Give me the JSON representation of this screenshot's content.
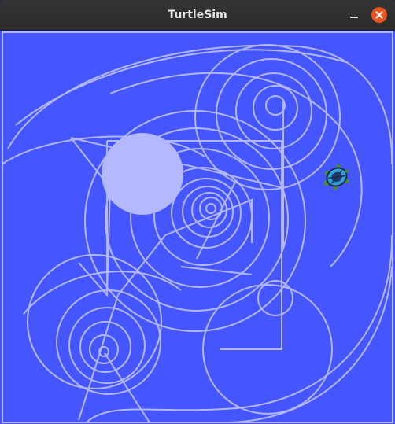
{
  "window": {
    "title": "TurtleSim",
    "controls": {
      "minimize_icon": "minimize-icon",
      "close_icon": "close-icon"
    }
  },
  "canvas": {
    "background_color": "#4556ff",
    "pen_color": "#b3b8ff",
    "turtle_icon": "turtle-icon"
  }
}
